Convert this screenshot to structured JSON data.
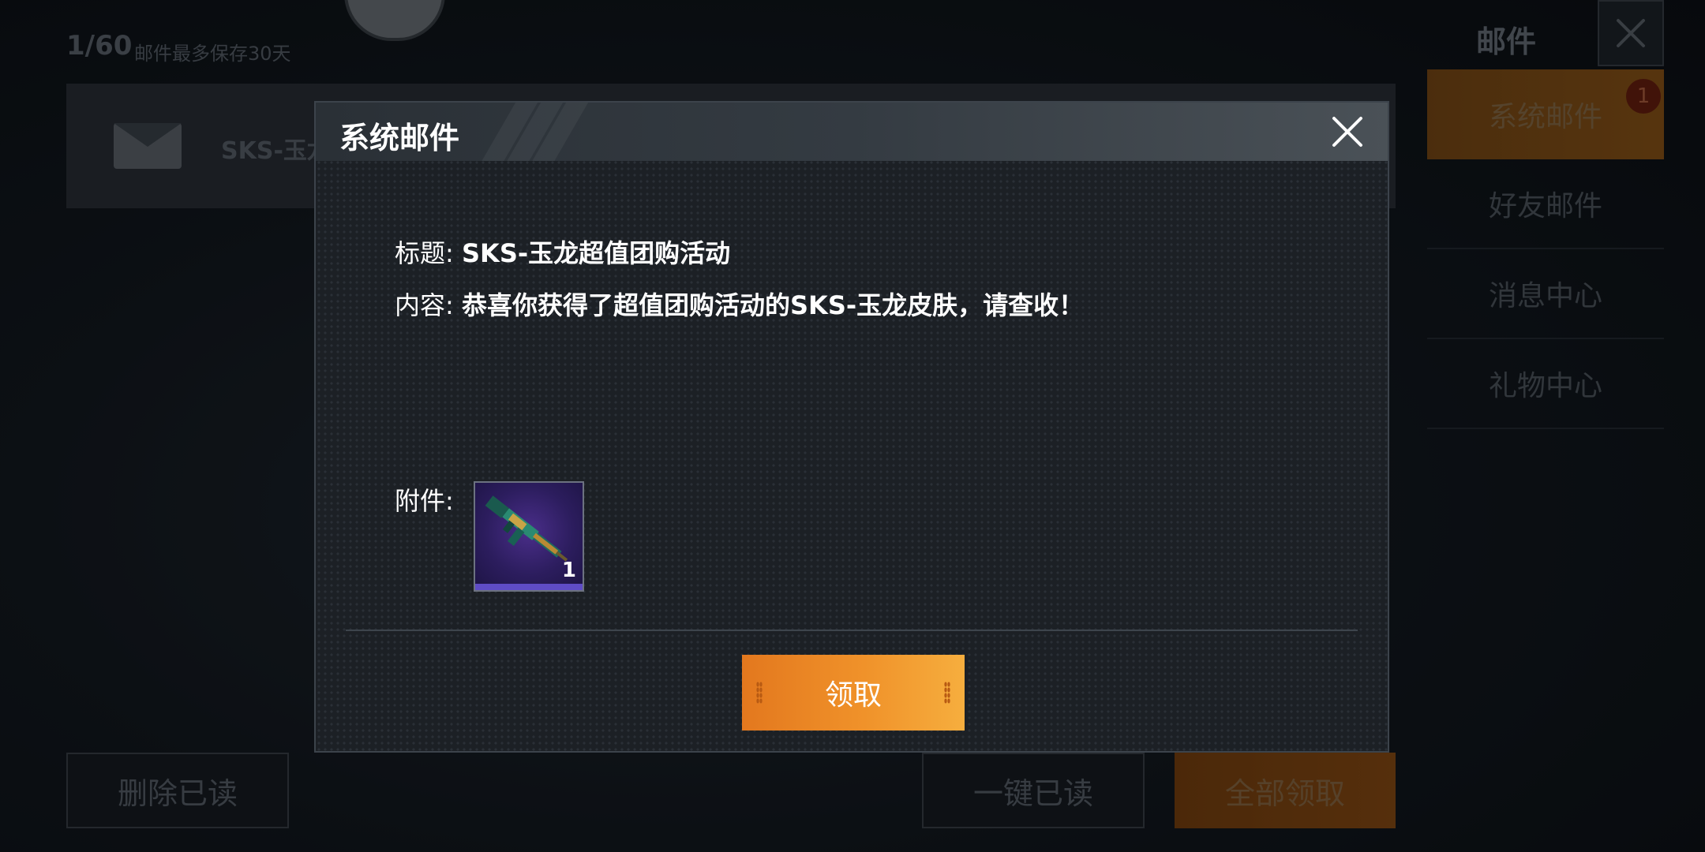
{
  "background": {
    "mail_count": "1/60",
    "mail_note": "邮件最多保存30天",
    "mail_item_title": "SKS-玉龙",
    "panel_title": "邮件",
    "tabs": [
      {
        "label": "系统邮件",
        "active": true
      },
      {
        "label": "好友邮件",
        "active": false
      },
      {
        "label": "消息中心",
        "active": false
      },
      {
        "label": "礼物中心",
        "active": false
      }
    ],
    "unread_badge": "1",
    "buttons": {
      "delete_read": "删除已读",
      "mark_all_read": "一键已读",
      "claim_all": "全部领取"
    }
  },
  "dialog": {
    "title": "系统邮件",
    "subject_label": "标题:",
    "subject_value": "SKS-玉龙超值团购活动",
    "content_label": "内容:",
    "content_value": "恭喜你获得了超值团购活动的SKS-玉龙皮肤，请查收！",
    "attachment_label": "附件:",
    "attachment": {
      "name": "SKS-玉龙",
      "count": "1",
      "rarity_color": "#5f4cc6"
    },
    "claim_label": "领取"
  },
  "colors": {
    "accent_orange": "#f0922a",
    "panel_bg": "#1c2025",
    "text": "#ffffff"
  }
}
